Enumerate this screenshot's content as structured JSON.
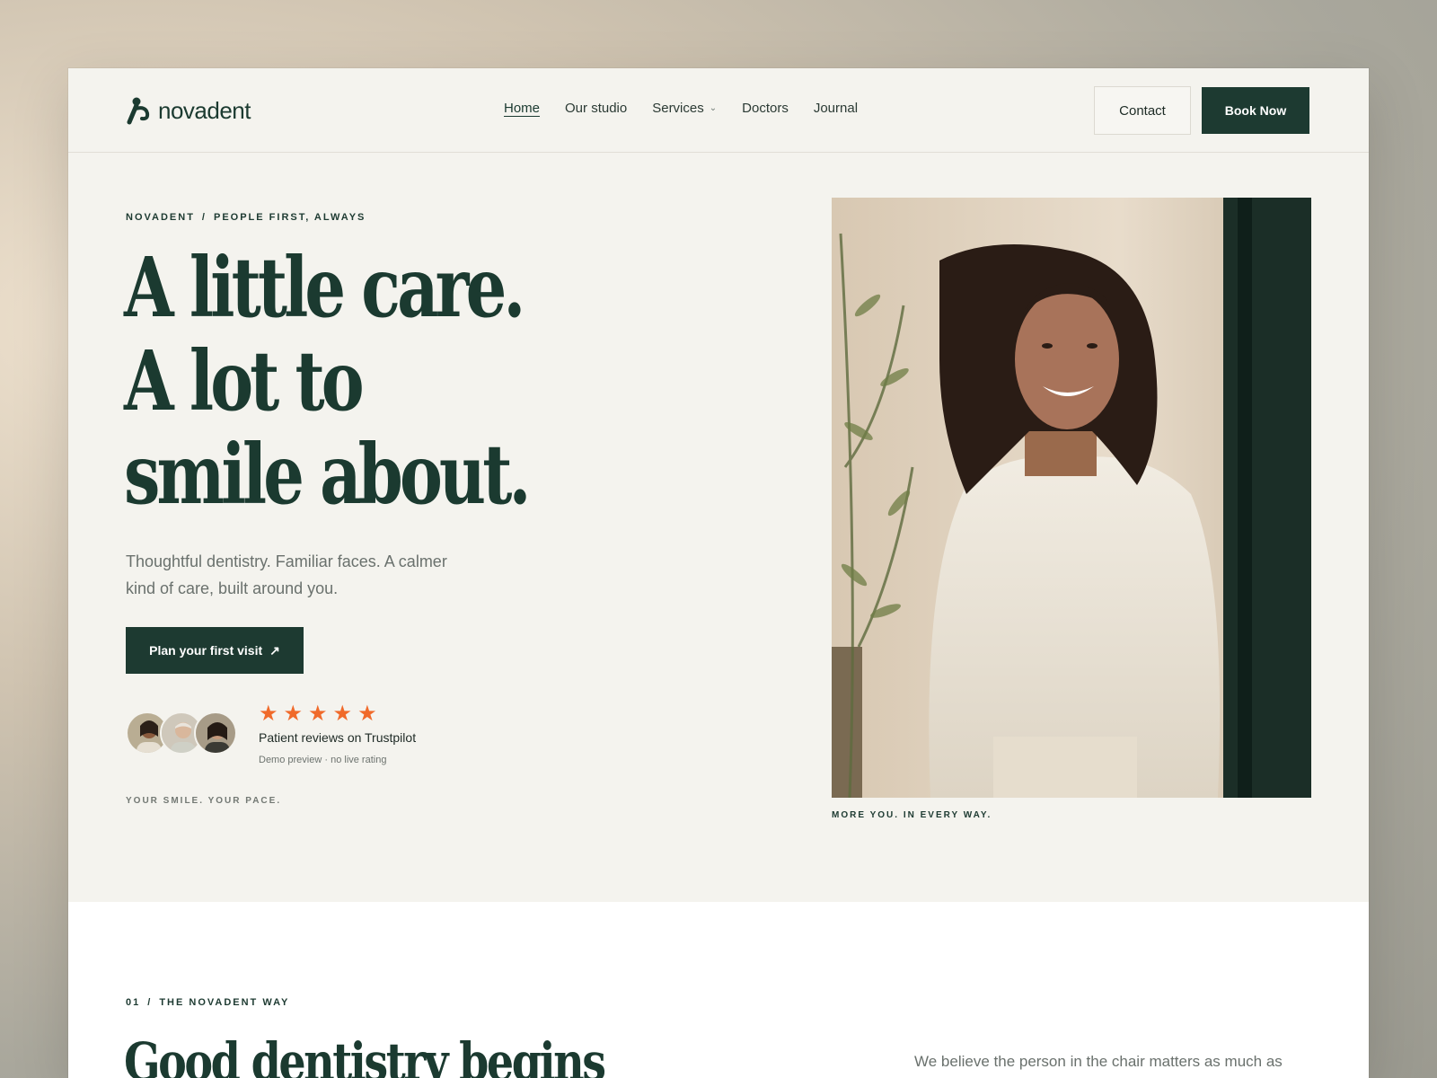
{
  "brand": {
    "name": "novadent"
  },
  "nav": {
    "items": [
      {
        "label": "Home",
        "active": true
      },
      {
        "label": "Our studio"
      },
      {
        "label": "Services",
        "dropdown": true
      },
      {
        "label": "Doctors"
      },
      {
        "label": "Journal"
      }
    ]
  },
  "header": {
    "contact_label": "Contact",
    "book_label": "Book Now"
  },
  "hero": {
    "eyebrow_left": "NOVADENT",
    "eyebrow_sep": "/",
    "eyebrow_right": "PEOPLE FIRST, ALWAYS",
    "headline_lines": [
      "A little care.",
      "A lot to",
      "smile about."
    ],
    "subtext": "Thoughtful dentistry. Familiar faces. A calmer kind of care, built around you.",
    "cta_label": "Plan your first visit",
    "cta_icon": "arrow-up-right-icon",
    "rating_stars": 5,
    "star_glyph": "★",
    "reviews_label": "Patient reviews on Trustpilot",
    "reviews_note": "Demo preview · no live rating",
    "tag_left": "YOUR SMILE. YOUR PACE.",
    "tag_right": "MORE YOU. IN EVERY WAY."
  },
  "section": {
    "number": "01",
    "sep": "/",
    "eyebrow": "THE NOVADENT WAY",
    "headline": "Good dentistry begins",
    "copy": "We believe the person in the chair matters as much as"
  },
  "colors": {
    "primary": "#1d3a31",
    "background": "#f4f3ee",
    "star": "#f06a2a",
    "muted_text": "#6a716d"
  }
}
